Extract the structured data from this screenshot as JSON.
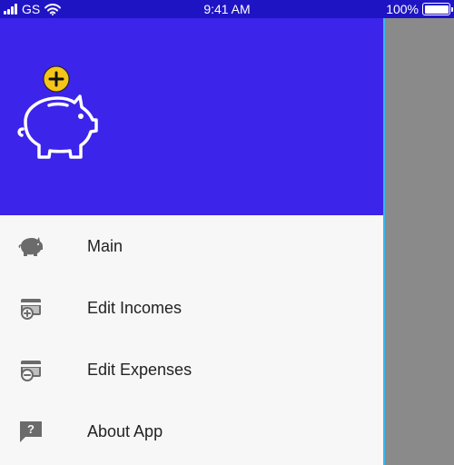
{
  "status_bar": {
    "carrier": "GS",
    "time": "9:41 AM",
    "battery": "100%"
  },
  "drawer": {
    "header": {
      "logo_icon": "piggy-bank-plus-icon"
    },
    "menu": [
      {
        "label": "Main",
        "icon": "piggy-bank-icon"
      },
      {
        "label": "Edit Incomes",
        "icon": "wallet-plus-icon"
      },
      {
        "label": "Edit Expenses",
        "icon": "wallet-minus-icon"
      },
      {
        "label": "About App",
        "icon": "help-bubble-icon"
      }
    ]
  },
  "colors": {
    "status_bar": "#1f14c4",
    "header": "#3c24ea",
    "accent_badge": "#f5c518",
    "drawer_bg": "#f7f7f7",
    "scrim": "#8a8a8a",
    "divider": "#38b6f2",
    "icon_gray": "#6b6b6b",
    "text": "#222222"
  }
}
